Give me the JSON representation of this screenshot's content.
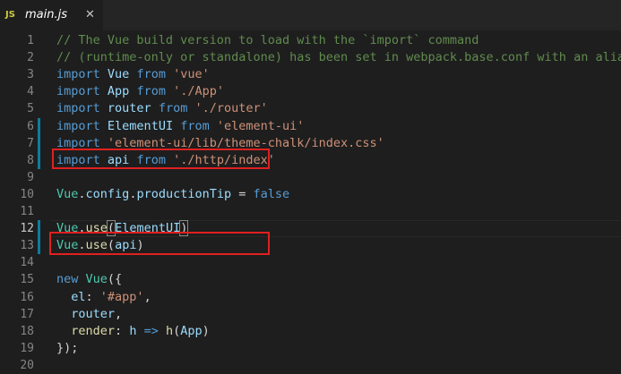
{
  "tab": {
    "lang_badge": "JS",
    "file_name": "main.js",
    "close_glyph": "✕"
  },
  "lines": [
    {
      "n": "1",
      "t": [
        {
          "c": "c-comment",
          "s": "// The Vue build version to load with the `import` command"
        }
      ]
    },
    {
      "n": "2",
      "t": [
        {
          "c": "c-comment",
          "s": "// (runtime-only or standalone) has been set in webpack.base.conf with an alias."
        }
      ]
    },
    {
      "n": "3",
      "t": [
        {
          "c": "c-kw",
          "s": "import"
        },
        {
          "c": "c-plain",
          "s": " "
        },
        {
          "c": "c-id",
          "s": "Vue"
        },
        {
          "c": "c-plain",
          "s": " "
        },
        {
          "c": "c-kw",
          "s": "from"
        },
        {
          "c": "c-plain",
          "s": " "
        },
        {
          "c": "c-str",
          "s": "'vue'"
        }
      ]
    },
    {
      "n": "4",
      "t": [
        {
          "c": "c-kw",
          "s": "import"
        },
        {
          "c": "c-plain",
          "s": " "
        },
        {
          "c": "c-id",
          "s": "App"
        },
        {
          "c": "c-plain",
          "s": " "
        },
        {
          "c": "c-kw",
          "s": "from"
        },
        {
          "c": "c-plain",
          "s": " "
        },
        {
          "c": "c-str",
          "s": "'./App'"
        }
      ]
    },
    {
      "n": "5",
      "t": [
        {
          "c": "c-kw",
          "s": "import"
        },
        {
          "c": "c-plain",
          "s": " "
        },
        {
          "c": "c-id",
          "s": "router"
        },
        {
          "c": "c-plain",
          "s": " "
        },
        {
          "c": "c-kw",
          "s": "from"
        },
        {
          "c": "c-plain",
          "s": " "
        },
        {
          "c": "c-str",
          "s": "'./router'"
        }
      ]
    },
    {
      "n": "6",
      "mod": true,
      "t": [
        {
          "c": "c-kw",
          "s": "import"
        },
        {
          "c": "c-plain",
          "s": " "
        },
        {
          "c": "c-id",
          "s": "ElementUI"
        },
        {
          "c": "c-plain",
          "s": " "
        },
        {
          "c": "c-kw",
          "s": "from"
        },
        {
          "c": "c-plain",
          "s": " "
        },
        {
          "c": "c-str",
          "s": "'element-ui'"
        }
      ]
    },
    {
      "n": "7",
      "mod": true,
      "t": [
        {
          "c": "c-kw",
          "s": "import"
        },
        {
          "c": "c-plain",
          "s": " "
        },
        {
          "c": "c-str",
          "s": "'element-ui/lib/theme-chalk/index.css'"
        }
      ]
    },
    {
      "n": "8",
      "mod": true,
      "t": [
        {
          "c": "c-kw",
          "s": "import"
        },
        {
          "c": "c-plain",
          "s": " "
        },
        {
          "c": "c-id",
          "s": "api"
        },
        {
          "c": "c-plain",
          "s": " "
        },
        {
          "c": "c-kw",
          "s": "from"
        },
        {
          "c": "c-plain",
          "s": " "
        },
        {
          "c": "c-str",
          "s": "'./http/index'"
        }
      ]
    },
    {
      "n": "9",
      "t": []
    },
    {
      "n": "10",
      "t": [
        {
          "c": "c-cls",
          "s": "Vue"
        },
        {
          "c": "c-plain",
          "s": "."
        },
        {
          "c": "c-id",
          "s": "config"
        },
        {
          "c": "c-plain",
          "s": "."
        },
        {
          "c": "c-id",
          "s": "productionTip"
        },
        {
          "c": "c-plain",
          "s": " = "
        },
        {
          "c": "c-kw",
          "s": "false"
        }
      ]
    },
    {
      "n": "11",
      "t": []
    },
    {
      "n": "12",
      "mod": true,
      "active": true,
      "t": [
        {
          "c": "c-cls",
          "s": "Vue"
        },
        {
          "c": "c-plain",
          "s": "."
        },
        {
          "c": "c-fn",
          "s": "use"
        },
        {
          "c": "c-plain bracket",
          "s": "("
        },
        {
          "c": "c-id",
          "s": "ElementUI"
        },
        {
          "c": "c-plain bracket",
          "s": ")"
        }
      ]
    },
    {
      "n": "13",
      "mod": true,
      "t": [
        {
          "c": "c-cls",
          "s": "Vue"
        },
        {
          "c": "c-plain",
          "s": "."
        },
        {
          "c": "c-fn",
          "s": "use"
        },
        {
          "c": "c-plain",
          "s": "("
        },
        {
          "c": "c-id",
          "s": "api"
        },
        {
          "c": "c-plain",
          "s": ")"
        }
      ]
    },
    {
      "n": "14",
      "t": []
    },
    {
      "n": "15",
      "t": [
        {
          "c": "c-kw",
          "s": "new"
        },
        {
          "c": "c-plain",
          "s": " "
        },
        {
          "c": "c-cls",
          "s": "Vue"
        },
        {
          "c": "c-plain",
          "s": "({"
        }
      ]
    },
    {
      "n": "16",
      "t": [
        {
          "c": "c-plain",
          "s": "  "
        },
        {
          "c": "c-id",
          "s": "el"
        },
        {
          "c": "c-plain",
          "s": ": "
        },
        {
          "c": "c-str",
          "s": "'#app'"
        },
        {
          "c": "c-plain",
          "s": ","
        }
      ]
    },
    {
      "n": "17",
      "t": [
        {
          "c": "c-plain",
          "s": "  "
        },
        {
          "c": "c-id",
          "s": "router"
        },
        {
          "c": "c-plain",
          "s": ","
        }
      ]
    },
    {
      "n": "18",
      "t": [
        {
          "c": "c-plain",
          "s": "  "
        },
        {
          "c": "c-fn",
          "s": "render"
        },
        {
          "c": "c-plain",
          "s": ": "
        },
        {
          "c": "c-id",
          "s": "h"
        },
        {
          "c": "c-plain",
          "s": " "
        },
        {
          "c": "c-kw",
          "s": "=>"
        },
        {
          "c": "c-plain",
          "s": " "
        },
        {
          "c": "c-fn",
          "s": "h"
        },
        {
          "c": "c-plain",
          "s": "("
        },
        {
          "c": "c-id",
          "s": "App"
        },
        {
          "c": "c-plain",
          "s": ")"
        }
      ]
    },
    {
      "n": "19",
      "t": [
        {
          "c": "c-plain",
          "s": "});"
        }
      ]
    },
    {
      "n": "20",
      "t": []
    }
  ],
  "highlight_color": "#e02020",
  "modified_gutter_color": "#0c7d9d"
}
